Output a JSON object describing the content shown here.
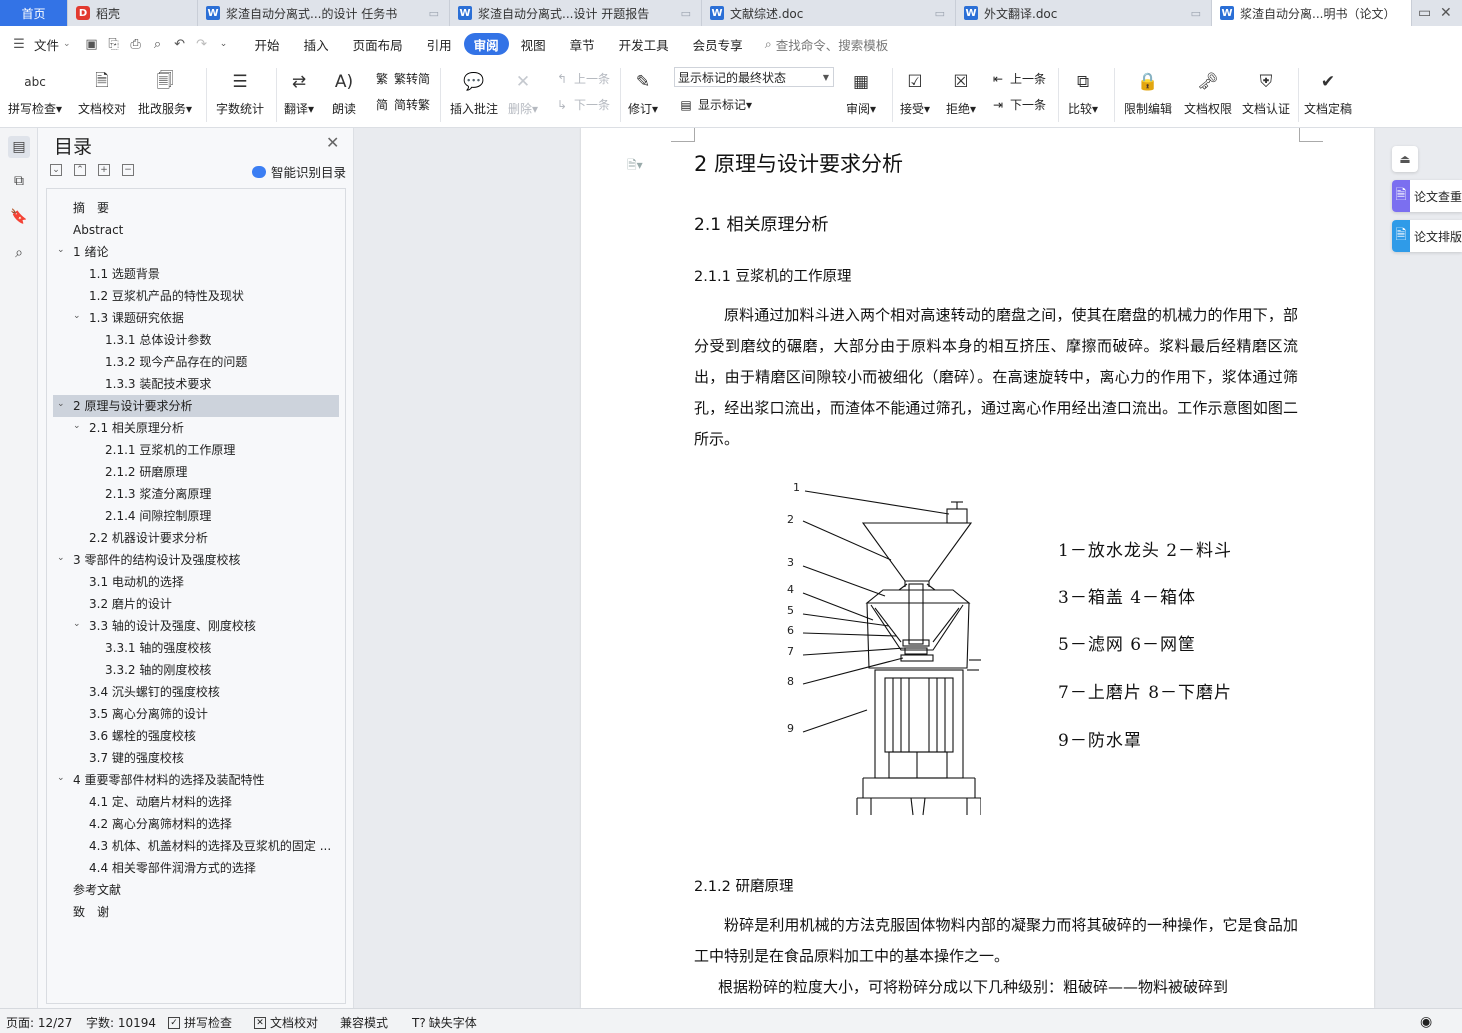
{
  "tabs": [
    {
      "label": "首页",
      "kind": "home"
    },
    {
      "label": "稻壳",
      "kind": "daoke"
    },
    {
      "label": "浆渣自动分离式...的设计 任务书",
      "kind": "doc"
    },
    {
      "label": "浆渣自动分离式...设计 开题报告",
      "kind": "doc"
    },
    {
      "label": "文献综述.doc",
      "kind": "doc"
    },
    {
      "label": "外文翻译.doc",
      "kind": "doc"
    },
    {
      "label": "浆渣自动分离...明书（论文）",
      "kind": "doc-active"
    }
  ],
  "menu": {
    "file_label": "文件",
    "items": [
      "开始",
      "插入",
      "页面布局",
      "引用",
      "审阅",
      "视图",
      "章节",
      "开发工具",
      "会员专享"
    ],
    "active": "审阅",
    "search_placeholder": "查找命令、搜索模板"
  },
  "ribbon": {
    "spell_check": "拼写检查",
    "doc_proof": "文档校对",
    "revise_service": "批改服务",
    "word_count": "字数统计",
    "translate": "翻译",
    "read_aloud": "朗读",
    "trad_simp": "繁转简",
    "simp_trad": "简转繁",
    "insert_comment": "插入批注",
    "delete": "删除",
    "prev_comment": "上一条",
    "next_comment": "下一条",
    "track_changes": "修订",
    "markup_select": "显示标记的最终状态",
    "show_markup": "显示标记",
    "review": "审阅",
    "accept": "接受",
    "reject": "拒绝",
    "prev_change": "上一条",
    "next_change": "下一条",
    "compare": "比较",
    "restrict_edit": "限制编辑",
    "doc_permission": "文档权限",
    "doc_certify": "文档认证",
    "doc_finalize": "文档定稿"
  },
  "toc": {
    "title": "目录",
    "smart_label": "智能识别目录",
    "items": [
      {
        "label": "摘　要",
        "level": 0,
        "arrow": false
      },
      {
        "label": "Abstract",
        "level": 0,
        "arrow": false
      },
      {
        "label": "1 绪论",
        "level": 0,
        "arrow": true
      },
      {
        "label": "1.1  选题背景",
        "level": 1,
        "arrow": false
      },
      {
        "label": "1.2  豆浆机产品的特性及现状",
        "level": 1,
        "arrow": false
      },
      {
        "label": "1.3  课题研究依据",
        "level": 1,
        "arrow": true
      },
      {
        "label": "1.3.1 总体设计参数",
        "level": 2,
        "arrow": false
      },
      {
        "label": "1.3.2  现今产品存在的问题",
        "level": 2,
        "arrow": false
      },
      {
        "label": "1.3.3  装配技术要求",
        "level": 2,
        "arrow": false
      },
      {
        "label": "2 原理与设计要求分析",
        "level": 0,
        "arrow": true,
        "selected": true
      },
      {
        "label": "2.1 相关原理分析",
        "level": 1,
        "arrow": true
      },
      {
        "label": "2.1.1  豆浆机的工作原理",
        "level": 2,
        "arrow": false
      },
      {
        "label": "2.1.2  研磨原理",
        "level": 2,
        "arrow": false
      },
      {
        "label": "2.1.3  浆渣分离原理",
        "level": 2,
        "arrow": false
      },
      {
        "label": "2.1.4  间隙控制原理",
        "level": 2,
        "arrow": false
      },
      {
        "label": "2.2  机器设计要求分析",
        "level": 1,
        "arrow": false
      },
      {
        "label": "3 零部件的结构设计及强度校核",
        "level": 0,
        "arrow": true
      },
      {
        "label": "3.1 电动机的选择",
        "level": 1,
        "arrow": false
      },
      {
        "label": "3.2  磨片的设计",
        "level": 1,
        "arrow": false
      },
      {
        "label": "3.3  轴的设计及强度、刚度校核",
        "level": 1,
        "arrow": true
      },
      {
        "label": "3.3.1  轴的强度校核",
        "level": 2,
        "arrow": false
      },
      {
        "label": "3.3.2  轴的刚度校核",
        "level": 2,
        "arrow": false
      },
      {
        "label": "3.4  沉头螺钉的强度校核",
        "level": 1,
        "arrow": false
      },
      {
        "label": "3.5  离心分离筛的设计",
        "level": 1,
        "arrow": false
      },
      {
        "label": "3.6  螺栓的强度校核",
        "level": 1,
        "arrow": false
      },
      {
        "label": "3.7  键的强度校核",
        "level": 1,
        "arrow": false
      },
      {
        "label": "4 重要零部件材料的选择及装配特性",
        "level": 0,
        "arrow": true
      },
      {
        "label": "4.1  定、动磨片材料的选择",
        "level": 1,
        "arrow": false
      },
      {
        "label": "4.2  离心分离筛材料的选择",
        "level": 1,
        "arrow": false
      },
      {
        "label": "4.3  机体、机盖材料的选择及豆浆机的固定 ...",
        "level": 1,
        "arrow": false
      },
      {
        "label": "4.4 相关零部件润滑方式的选择",
        "level": 1,
        "arrow": false
      },
      {
        "label": "参考文献",
        "level": 0,
        "arrow": false
      },
      {
        "label": "致　谢",
        "level": 0,
        "arrow": false
      }
    ]
  },
  "document": {
    "h1": "2 原理与设计要求分析",
    "h2": "2.1 相关原理分析",
    "h3_1": "2.1.1  豆浆机的工作原理",
    "para1": "原料通过加料斗进入两个相对高速转动的磨盘之间，使其在磨盘的机械力的作用下，部分受到磨纹的碾磨，大部分由于原料本身的相互挤压、摩擦而破碎。浆料最后经精磨区流出，由于精磨区间隙较小而被细化（磨碎）。在高速旋转中，离心力的作用下，浆体通过筛孔，经出浆口流出，而渣体不能通过筛孔，通过离心作用经出渣口流出。工作示意图如图二所示。",
    "figure_numbers": [
      "1",
      "2",
      "3",
      "4",
      "5",
      "6",
      "7",
      "8",
      "9"
    ],
    "legend": [
      "1－放水龙头  2－料斗",
      "3－箱盖  4－箱体",
      "5－滤网  6－网筐",
      "7－上磨片  8－下磨片",
      "9－防水罩"
    ],
    "h3_2": "2.1.2  研磨原理",
    "para2": "粉碎是利用机械的方法克服固体物料内部的凝聚力而将其破碎的一种操作，它是食品加工中特别是在食品原料加工中的基本操作之一。",
    "para3": "根据粉碎的粒度大小，可将粉碎分成以下几种级别：粗破碎——物料被破碎到"
  },
  "right_panel": {
    "btn1": "论文查重",
    "btn2": "论文排版"
  },
  "status": {
    "page": "页面: 12/27",
    "words": "字数: 10194",
    "spell": "拼写检查",
    "proof": "文档校对",
    "compat": "兼容模式",
    "missing_font": "缺失字体"
  },
  "colors": {
    "accent": "#3373e6",
    "tab_bar": "#dfe3ea",
    "selected_toc": "#cdd3dc"
  }
}
